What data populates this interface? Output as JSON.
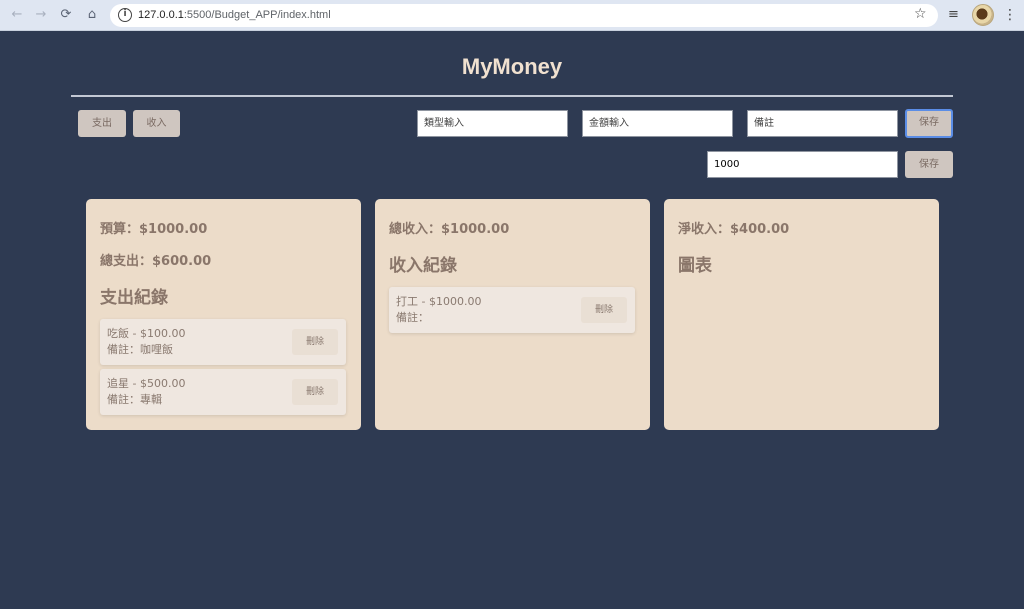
{
  "browser": {
    "url_host": "127.0.0.1",
    "url_path": ":5500/Budget_APP/index.html",
    "back_icon": "←",
    "forward_icon": "→",
    "reload_icon": "⟳",
    "home_icon": "⌂",
    "info_icon": "i",
    "star_icon": "☆",
    "media_icon": "≡",
    "menu_icon": "⋮"
  },
  "app": {
    "title": "MyMoney"
  },
  "controls": {
    "expense_tab": "支出",
    "income_tab": "收入",
    "type_placeholder": "類型輸入",
    "amount_placeholder": "金額輸入",
    "note_placeholder": "備註",
    "save_label": "保存",
    "budget_value": "1000",
    "budget_save_label": "保存"
  },
  "expense_card": {
    "budget": "預算：$1000.00",
    "total_expense": "總支出：$600.00",
    "heading": "支出紀錄",
    "records": [
      {
        "line1": "吃飯 - $100.00",
        "line2": "備註：咖哩飯",
        "delete": "刪除"
      },
      {
        "line1": "追星 - $500.00",
        "line2": "備註：專輯",
        "delete": "刪除"
      }
    ]
  },
  "income_card": {
    "total_income": "總收入：$1000.00",
    "heading": "收入紀錄",
    "records": [
      {
        "line1": "打工 - $1000.00",
        "line2": "備註：",
        "delete": "刪除"
      }
    ]
  },
  "summary_card": {
    "net_income": "淨收入：$400.00",
    "heading": "圖表"
  },
  "colors": {
    "background": "#2e3a52",
    "card": "#ecdcc9",
    "title": "#f1e1d0",
    "text": "#8a766a"
  }
}
